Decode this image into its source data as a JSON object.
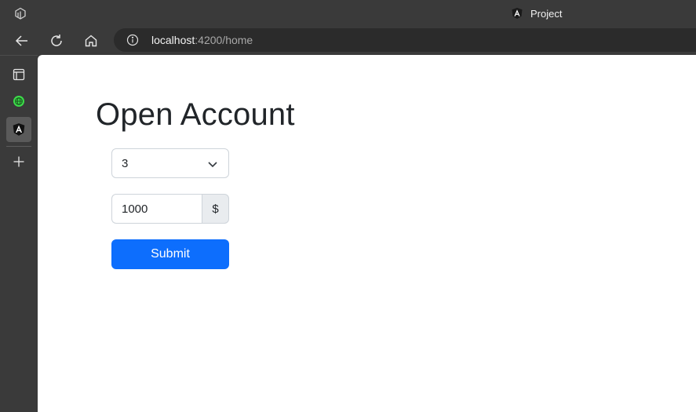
{
  "browser": {
    "tab_title": "Project",
    "address": {
      "host": "localhost",
      "rest": ":4200/home"
    }
  },
  "sidebar": {
    "items": [
      "workspaces-icon",
      "vpn-icon",
      "angular-tab-icon",
      "add-icon"
    ]
  },
  "page": {
    "heading": "Open Account",
    "select_value": "3",
    "amount_value": "1000",
    "currency_symbol": "$",
    "submit_label": "Submit"
  },
  "colors": {
    "chrome": "#3a3a3a",
    "primary": "#0d6efd",
    "addon_bg": "#e9ecef"
  }
}
